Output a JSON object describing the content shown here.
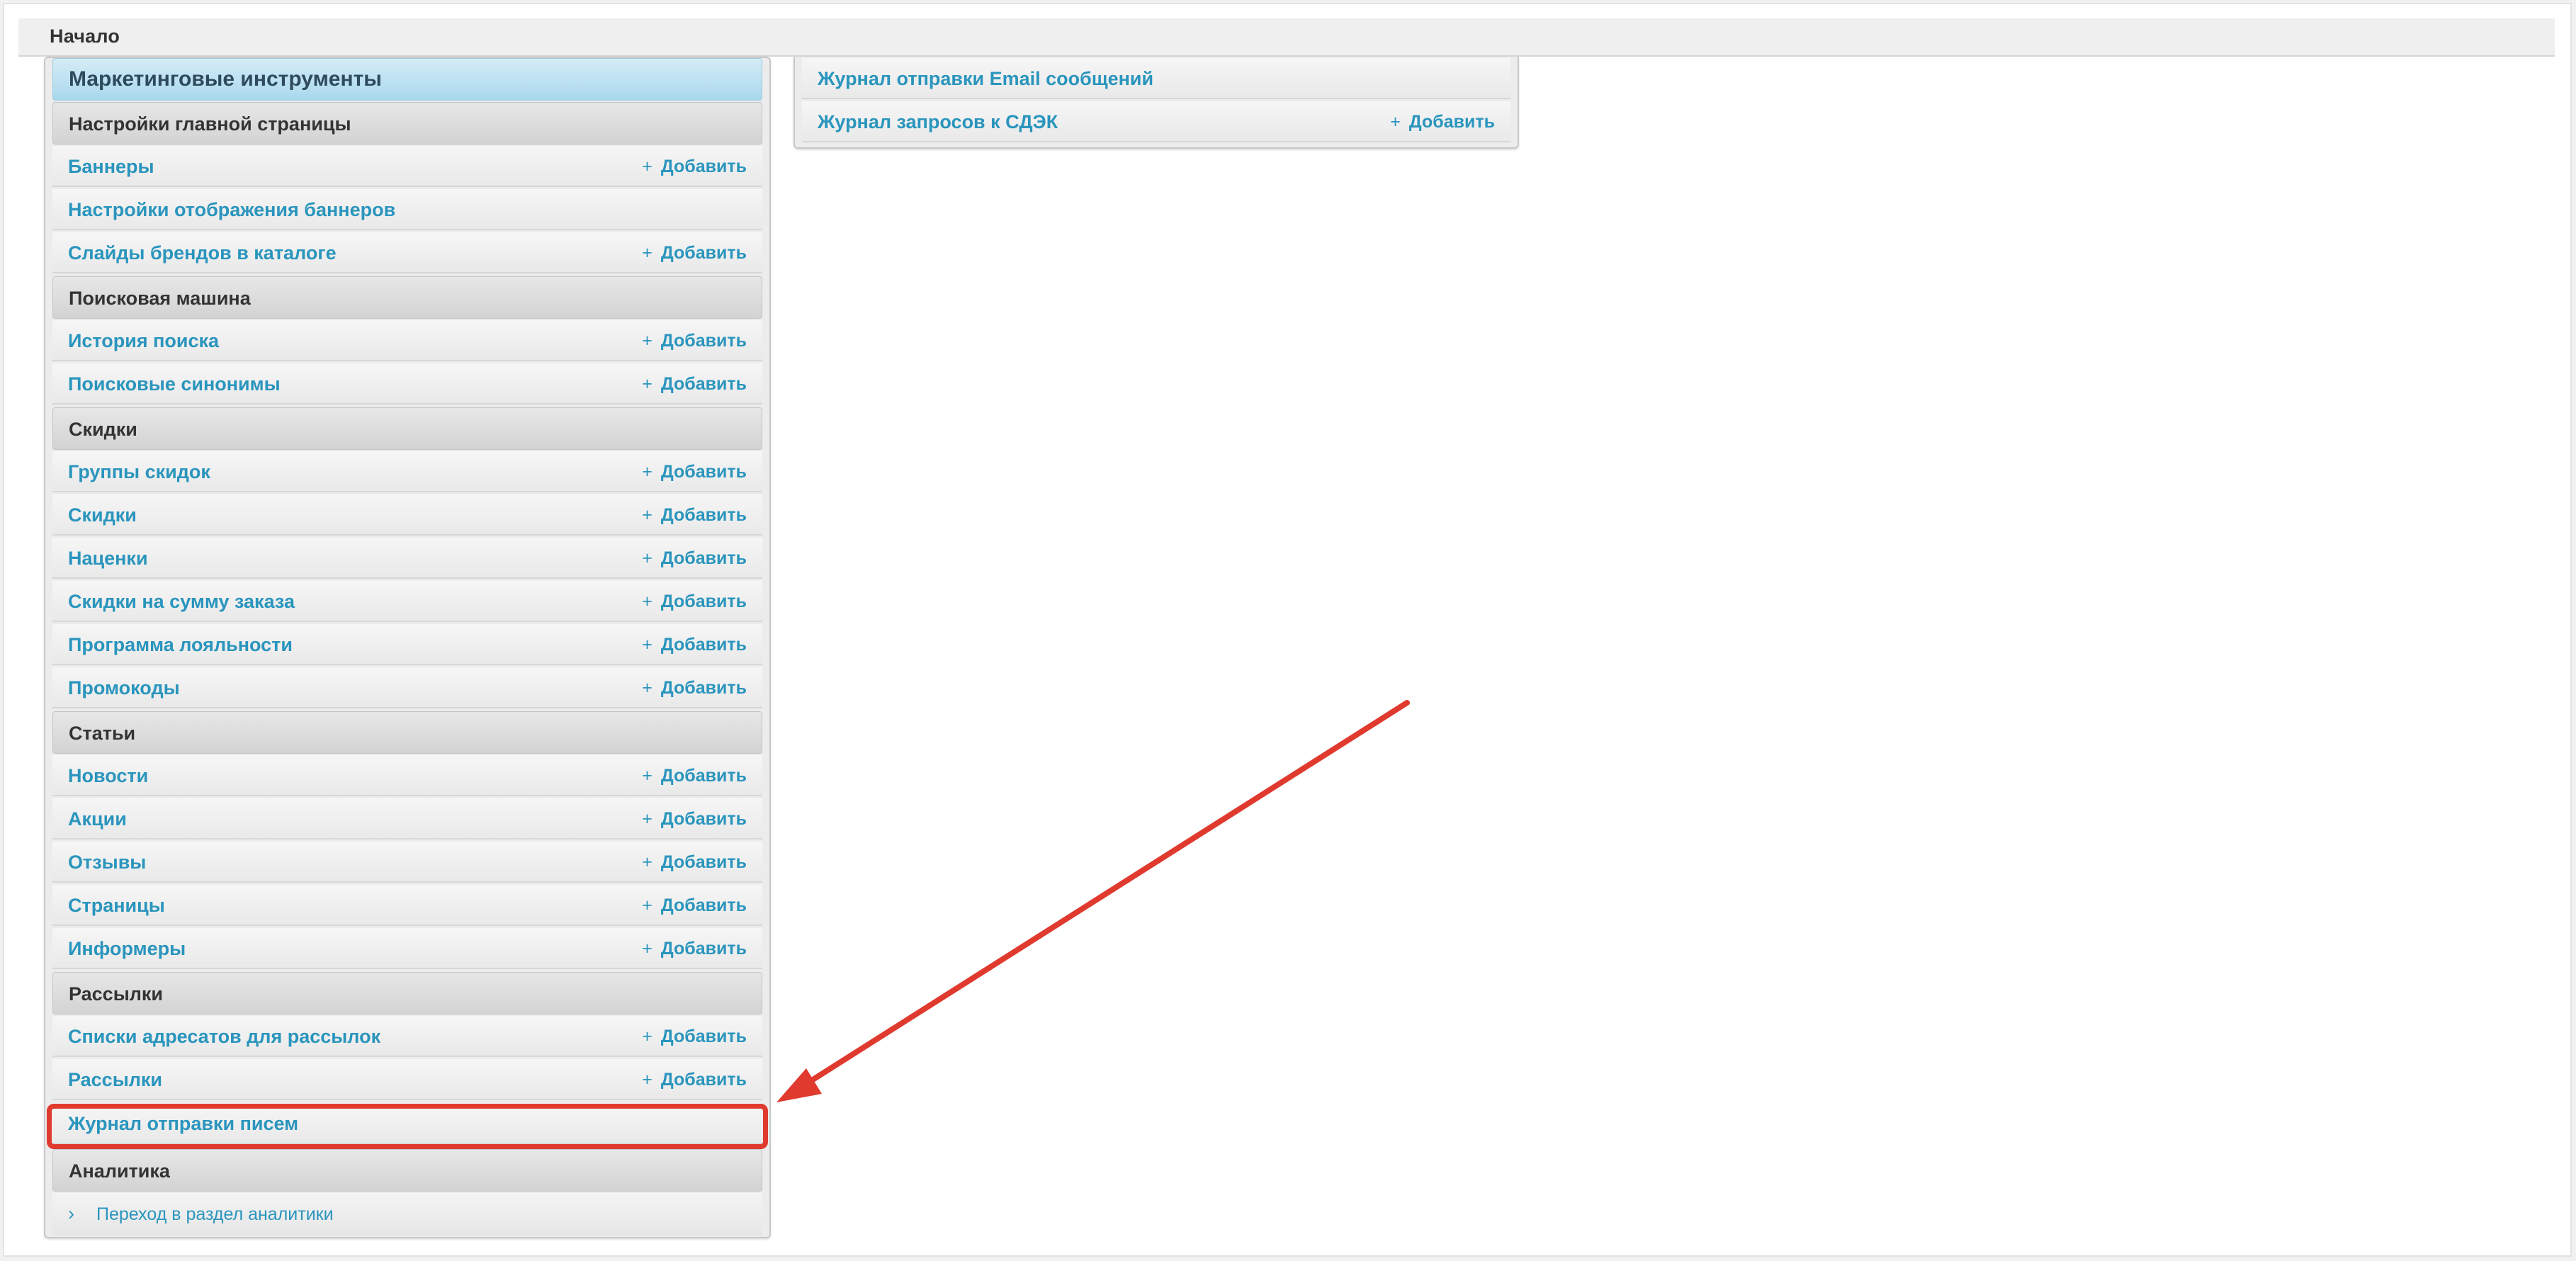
{
  "breadcrumb": "Начало",
  "panel_title": "Маркетинговые инструменты",
  "add_label": "Добавить",
  "plus_glyph": "+",
  "left_panel": {
    "groups": [
      {
        "title": "Настройки главной страницы",
        "items": [
          {
            "label": "Баннеры",
            "add": true
          },
          {
            "label": "Настройки отображения баннеров",
            "add": false
          },
          {
            "label": "Слайды брендов в каталоге",
            "add": true
          }
        ]
      },
      {
        "title": "Поисковая машина",
        "items": [
          {
            "label": "История поиска",
            "add": true
          },
          {
            "label": "Поисковые синонимы",
            "add": true
          }
        ]
      },
      {
        "title": "Скидки",
        "items": [
          {
            "label": "Группы скидок",
            "add": true
          },
          {
            "label": "Скидки",
            "add": true
          },
          {
            "label": "Наценки",
            "add": true
          },
          {
            "label": "Скидки на сумму заказа",
            "add": true
          },
          {
            "label": "Программа лояльности",
            "add": true
          },
          {
            "label": "Промокоды",
            "add": true
          }
        ]
      },
      {
        "title": "Статьи",
        "items": [
          {
            "label": "Новости",
            "add": true
          },
          {
            "label": "Акции",
            "add": true
          },
          {
            "label": "Отзывы",
            "add": true
          },
          {
            "label": "Страницы",
            "add": true
          },
          {
            "label": "Информеры",
            "add": true
          }
        ]
      },
      {
        "title": "Рассылки",
        "items": [
          {
            "label": "Списки адресатов для рассылок",
            "add": true
          },
          {
            "label": "Рассылки",
            "add": true
          },
          {
            "label": "Журнал отправки писем",
            "add": false,
            "highlighted": true
          }
        ]
      },
      {
        "title": "Аналитика",
        "items": []
      }
    ],
    "analytics_link": "Переход в раздел аналитики"
  },
  "right_panel": {
    "items": [
      {
        "label": "Журнал отправки Email сообщений",
        "add": false
      },
      {
        "label": "Журнал запросов к СДЭК",
        "add": true
      }
    ]
  },
  "colors": {
    "link": "#2a95bd",
    "highlight": "#e03a2f",
    "header_blue": "#a9d8ec"
  },
  "icons": {
    "plus": "plus-icon",
    "chevron": "chevron-right-icon"
  }
}
